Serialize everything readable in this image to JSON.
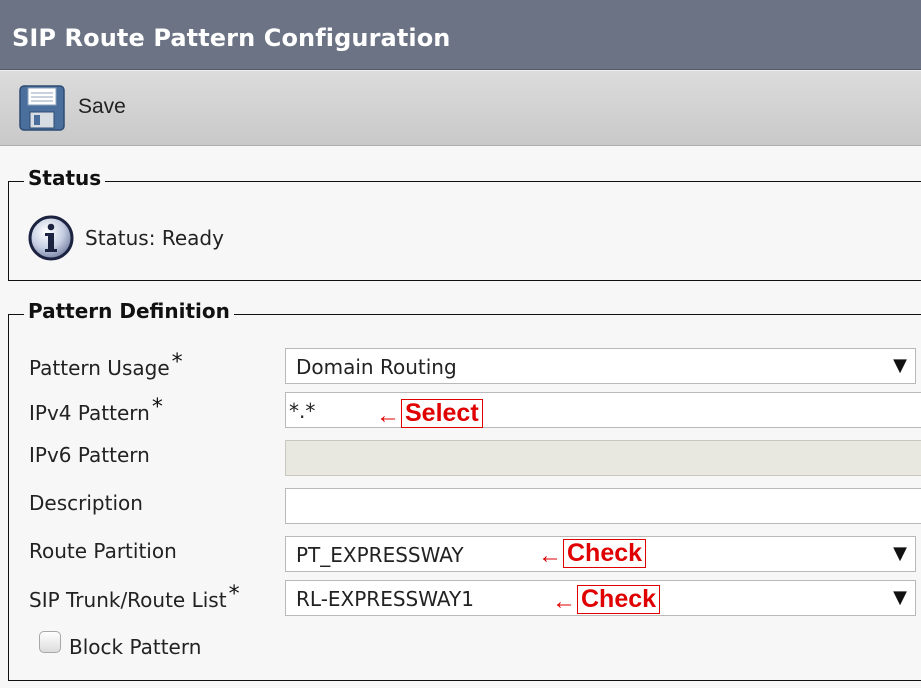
{
  "header": {
    "title": "SIP Route Pattern Configuration"
  },
  "toolbar": {
    "save_label": "Save"
  },
  "status": {
    "legend": "Status",
    "text": "Status: Ready"
  },
  "pattern_definition": {
    "legend": "Pattern Definition",
    "pattern_usage": {
      "label": "Pattern Usage",
      "required": "*",
      "value": "Domain Routing"
    },
    "ipv4_pattern": {
      "label": "IPv4 Pattern",
      "required": "*",
      "value": "*.*"
    },
    "ipv6_pattern": {
      "label": "IPv6 Pattern",
      "value": ""
    },
    "description": {
      "label": "Description",
      "value": ""
    },
    "route_partition": {
      "label": "Route Partition",
      "value": "PT_EXPRESSWAY"
    },
    "sip_trunk": {
      "label": "SIP Trunk/Route List",
      "required": "*",
      "value": "RL-EXPRESSWAY1"
    },
    "block_pattern": {
      "label": "Block Pattern",
      "checked": false
    }
  },
  "annotations": {
    "arrow": "←",
    "ipv4_note": "Select",
    "partition_note": "Check",
    "trunk_note": "Check",
    "color": "#e00000"
  },
  "icons": {
    "save": "floppy-disk-icon",
    "status": "info-icon",
    "dropdown": "dropdown-caret-icon"
  },
  "colors": {
    "titlebar": "#6b7384",
    "toolbar": "#d3d3d3",
    "page_background": "#f7f7f7"
  }
}
